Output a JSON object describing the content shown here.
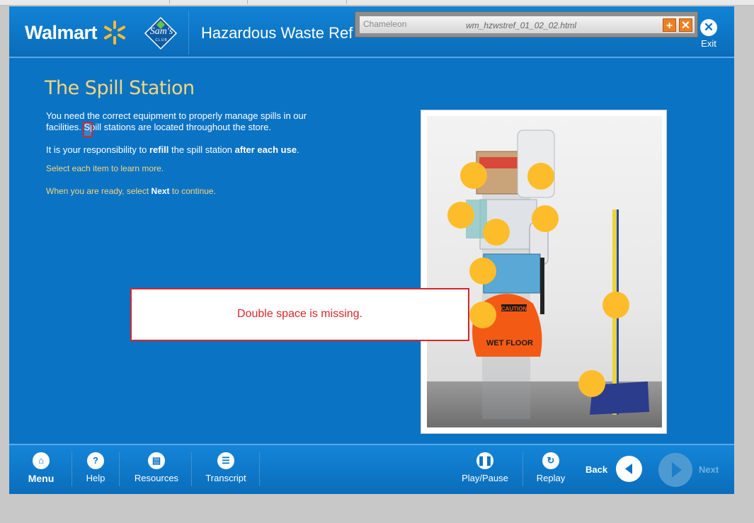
{
  "header": {
    "walmart_logo": "Walmart",
    "sams_logo": "Sam's",
    "sams_logo_sub": "CLUB",
    "course_title": "Hazardous Waste Ref",
    "exit_label": "Exit"
  },
  "chameleon_bar": {
    "logo": "Chameleon",
    "file_name": "wm_hzwstref_01_02_02.html"
  },
  "content": {
    "title": "The Spill Station",
    "p1": "You need the correct equipment to properly manage spills in our facilities. Spill stations are located throughout the store.",
    "p2_a": "It is your responsibility to ",
    "p2_b": "refill",
    "p2_c": " the spill station ",
    "p2_d": "after each use",
    "p2_e": ".",
    "hint1": "Select each item to learn more.",
    "hint2_a": "When you are ready, select ",
    "hint2_b": "Next",
    "hint2_c": " to continue."
  },
  "photo_labels": {
    "caution": "CAUTION",
    "wet_floor": "WET FLOOR"
  },
  "callout": {
    "text": "Double space is missing."
  },
  "footer": {
    "menu": "Menu",
    "help": "Help",
    "resources": "Resources",
    "transcript": "Transcript",
    "play_pause": "Play/Pause",
    "replay": "Replay",
    "back": "Back",
    "next": "Next"
  },
  "colors": {
    "background": "#0a73c4",
    "title": "#f5d67b",
    "hotspot": "#fdbd2b",
    "callout_border": "#d8262c"
  }
}
